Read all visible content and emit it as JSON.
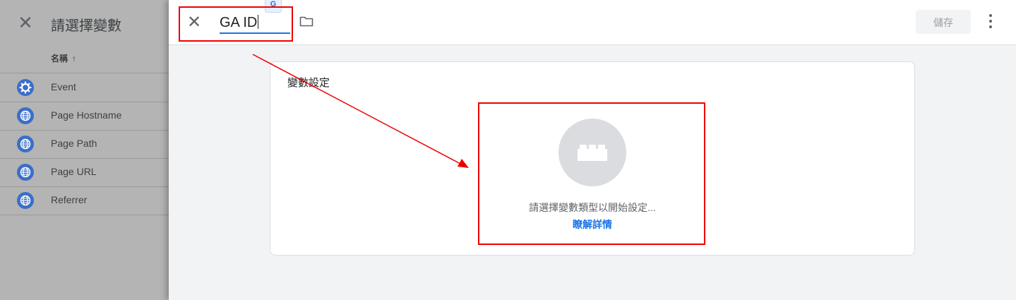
{
  "left_panel": {
    "title": "請選擇變數",
    "column_header": "名稱",
    "sort_arrow": "↑",
    "items": [
      {
        "label": "Event",
        "icon": "gear-icon"
      },
      {
        "label": "Page Hostname",
        "icon": "globe-icon"
      },
      {
        "label": "Page Path",
        "icon": "globe-icon"
      },
      {
        "label": "Page URL",
        "icon": "globe-icon"
      },
      {
        "label": "Referrer",
        "icon": "globe-icon"
      }
    ]
  },
  "editor": {
    "variable_name": "GA ID",
    "save_label": "儲存",
    "translate_badge": "G"
  },
  "card": {
    "header": "變數設定",
    "message": "請選擇變數類型以開始設定...",
    "link": "瞭解詳情"
  },
  "colors": {
    "accent": "#1a73e8",
    "annotation": "#e00000",
    "icon_bg": "#3b6ec8"
  }
}
